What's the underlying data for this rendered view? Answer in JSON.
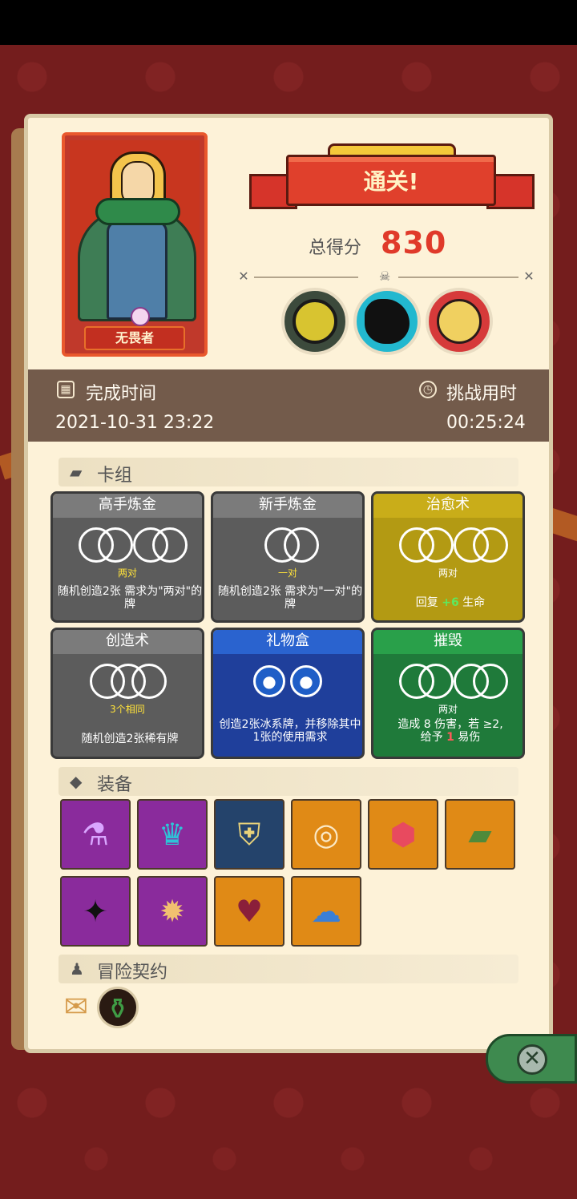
{
  "hero": {
    "name": "无畏者"
  },
  "result": {
    "banner": "通关!",
    "score_label": "总得分",
    "score_value": "830"
  },
  "bosses": [
    {
      "name": "armored-knight-boss-icon"
    },
    {
      "name": "shadow-beast-boss-icon"
    },
    {
      "name": "skull-mask-boss-icon"
    }
  ],
  "time": {
    "finish_label": "完成时间",
    "finish_value": "2021-10-31 23:22",
    "challenge_label": "挑战用时",
    "challenge_value": "00:25:24"
  },
  "sections": {
    "deck": "卡组",
    "equipment": "装备",
    "contract": "冒险契约"
  },
  "cards": [
    {
      "title": "高手炼金",
      "requirement": "两对",
      "desc": "随机创造2张 需求为\"两对\"的牌",
      "color": "#5c5c5c"
    },
    {
      "title": "新手炼金",
      "requirement": "一对",
      "desc": "随机创造2张 需求为\"一对\"的牌",
      "color": "#5c5c5c"
    },
    {
      "title": "治愈术",
      "requirement": "两对",
      "desc_prefix": "回复 ",
      "desc_amount": "+6",
      "desc_suffix": " 生命",
      "color": "#b39a13"
    },
    {
      "title": "创造术",
      "requirement": "3个相同",
      "desc": "随机创造2张稀有牌",
      "color": "#5c5c5c"
    },
    {
      "title": "礼物盒",
      "requirement": "",
      "desc": "创造2张冰系牌，并移除其中1张的使用需求",
      "color": "#1f3f9b"
    },
    {
      "title": "摧毁",
      "requirement": "两对",
      "desc_line1": "造成 8 伤害，若 ≥2,",
      "desc_line2_prefix": "给予 ",
      "desc_line2_amount": "1",
      "desc_line2_suffix": " 易伤",
      "color": "#1f7a3a"
    }
  ],
  "equipment": [
    {
      "icon": "purple-potion-icon",
      "color": "#8a2b9c"
    },
    {
      "icon": "demon-mask-icon",
      "color": "#8a2b9c"
    },
    {
      "icon": "compass-armor-icon",
      "color": "#24436b"
    },
    {
      "icon": "gold-ring-icon",
      "color": "#e08a16"
    },
    {
      "icon": "crystal-jar-icon",
      "color": "#e08a16"
    },
    {
      "icon": "moss-brick-icon",
      "color": "#e08a16"
    },
    {
      "icon": "shadow-dice-icon",
      "color": "#8a2b9c"
    },
    {
      "icon": "spiked-dice-icon",
      "color": "#8a2b9c"
    },
    {
      "icon": "thorn-heart-icon",
      "color": "#e08a16"
    },
    {
      "icon": "blue-mushroom-icon",
      "color": "#e08a16"
    }
  ],
  "contracts": [
    {
      "icon": "scroll-icon"
    },
    {
      "icon": "potion-badge-icon"
    }
  ]
}
